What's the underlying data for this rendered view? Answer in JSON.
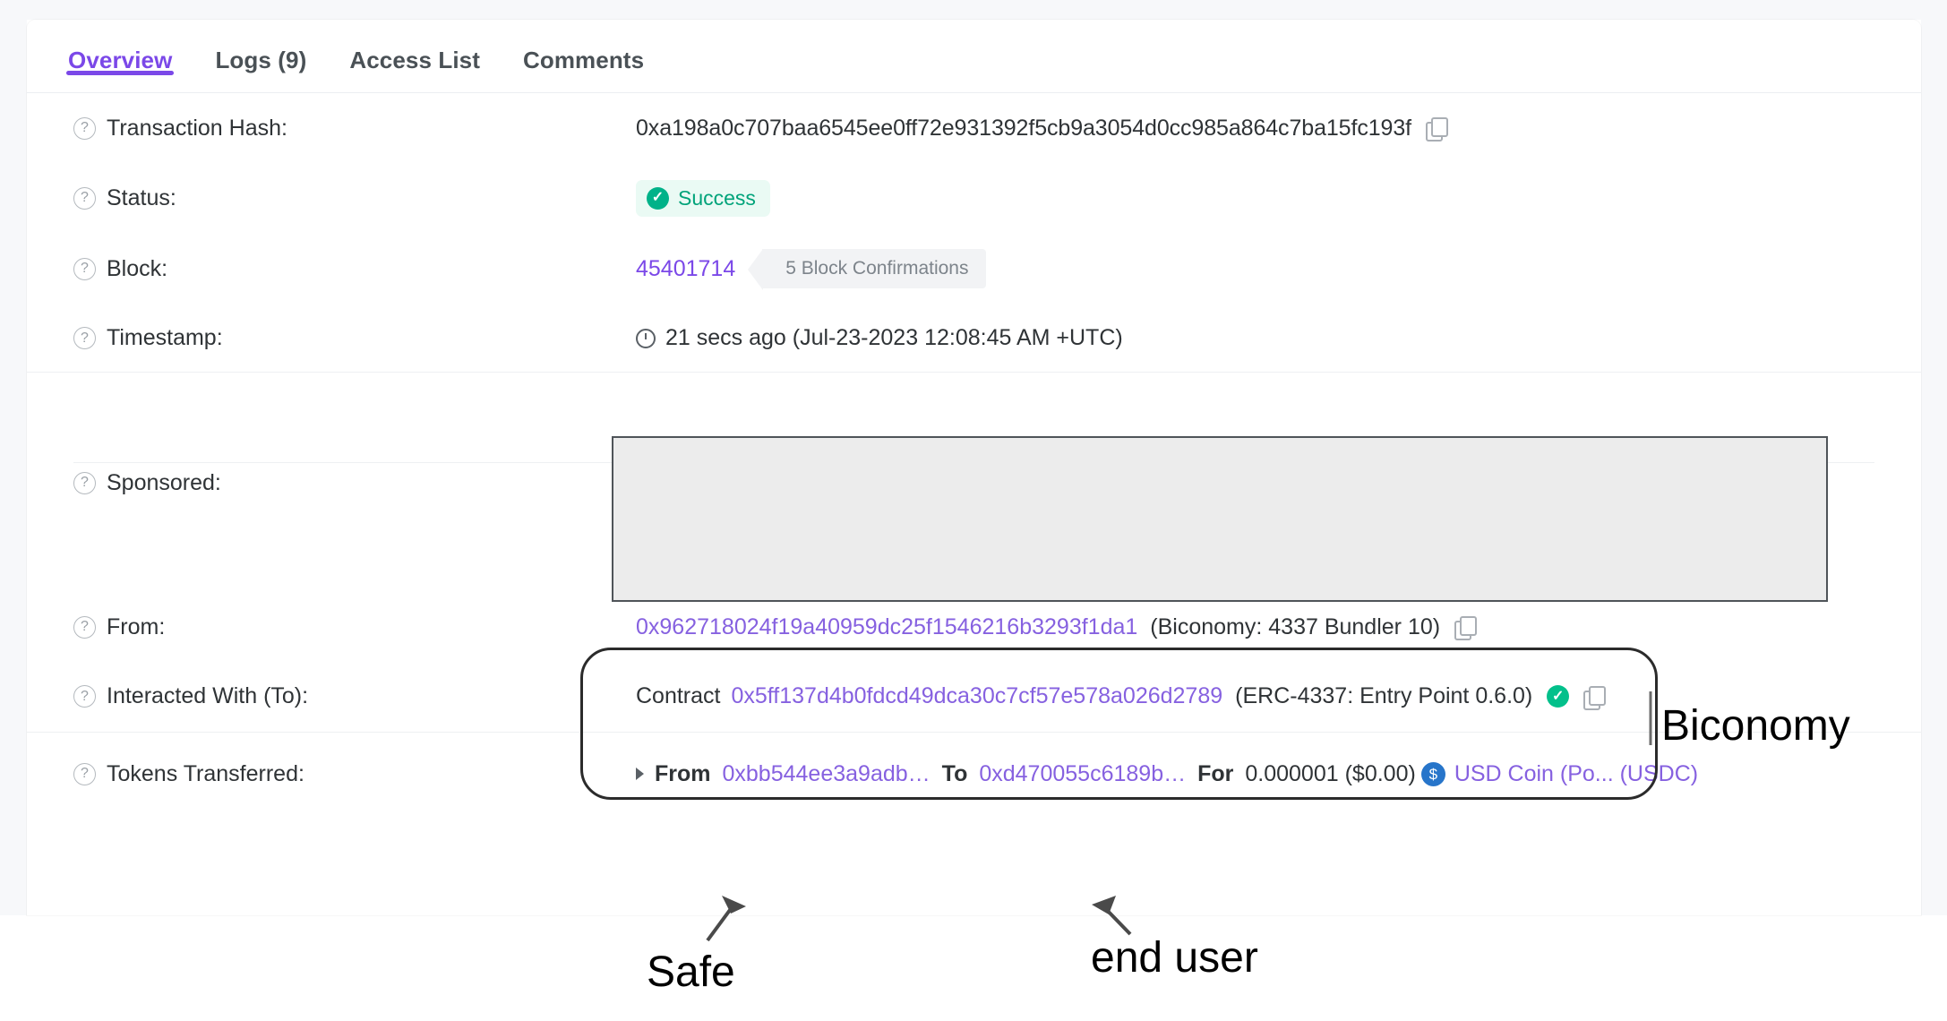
{
  "tabs": [
    {
      "label": "Overview",
      "active": true
    },
    {
      "label": "Logs (9)",
      "active": false
    },
    {
      "label": "Access List",
      "active": false
    },
    {
      "label": "Comments",
      "active": false
    }
  ],
  "rows": {
    "transaction_hash": {
      "label": "Transaction Hash:",
      "value": "0xa198a0c707baa6545ee0ff72e931392f5cb9a3054d0cc985a864c7ba15fc193f"
    },
    "status": {
      "label": "Status:",
      "value": "Success"
    },
    "block": {
      "label": "Block:",
      "number": "45401714",
      "confirmations": "5 Block Confirmations"
    },
    "timestamp": {
      "label": "Timestamp:",
      "value": "21 secs ago (Jul-23-2023 12:08:45 AM +UTC)"
    },
    "sponsored": {
      "label": "Sponsored:"
    },
    "from": {
      "label": "From:",
      "address": "0x962718024f19a40959dc25f1546216b3293f1da1",
      "tag": "(Biconomy: 4337 Bundler 10)"
    },
    "interacted_with": {
      "label": "Interacted With (To):",
      "prefix": "Contract",
      "address": "0x5ff137d4b0fdcd49dca30c7cf57e578a026d2789",
      "tag": "(ERC-4337: Entry Point 0.6.0)"
    },
    "tokens_transferred": {
      "label": "Tokens Transferred:",
      "from_kw": "From",
      "from_address": "0xbb544ee3a9adb…",
      "to_kw": "To",
      "to_address": "0xd470055c6189b…",
      "for_kw": "For",
      "amount": "0.000001 ($0.00)",
      "token": "USD Coin (Po... (USDC)",
      "token_symbol": "$"
    }
  },
  "annotations": {
    "biconomy": "Biconomy",
    "safe": "Safe",
    "end_user": "end user"
  },
  "colors": {
    "accent_purple": "#7b48e8",
    "link_purple": "#8661e0",
    "success_green": "#00b289",
    "usdc_blue": "#2775ca"
  }
}
